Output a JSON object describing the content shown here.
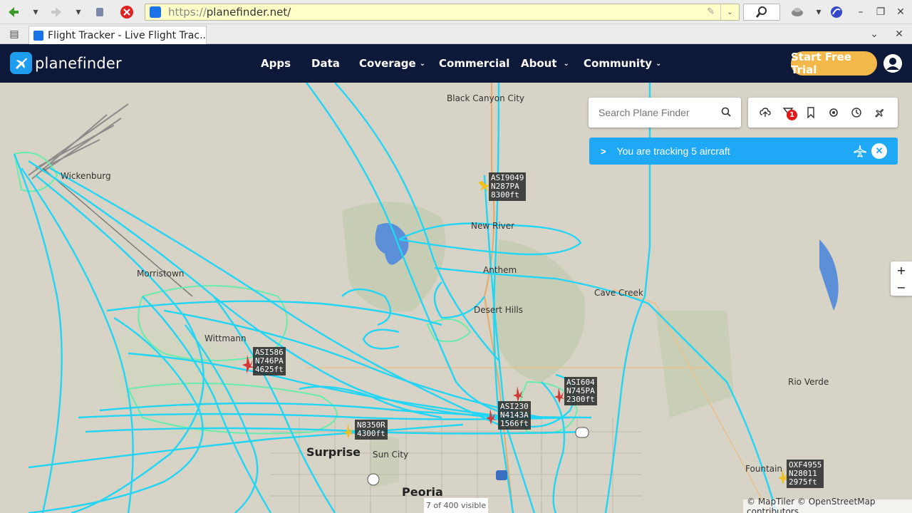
{
  "browser": {
    "url_scheme": "https://",
    "url_host": "planefinder.net/",
    "tab_title": "Flight Tracker - Live Flight Trac..."
  },
  "site": {
    "logo_text": "planefinder",
    "nav": [
      {
        "label": "Apps",
        "has_menu": false
      },
      {
        "label": "Data",
        "has_menu": false
      },
      {
        "label": "Coverage",
        "has_menu": true
      },
      {
        "label": "Commercial",
        "has_menu": false
      },
      {
        "label": "About",
        "has_menu": true
      },
      {
        "label": "Community",
        "has_menu": true
      }
    ],
    "trial_label": "Start Free Trial"
  },
  "search": {
    "placeholder": "Search Plane Finder"
  },
  "toolbar_icons": [
    "cloud-upload-icon",
    "filter-icon",
    "bookmark-icon",
    "settings-icon",
    "history-icon",
    "aircraft-icon"
  ],
  "filter_badge": "1",
  "tracking": {
    "text": "You are tracking 5 aircraft"
  },
  "zoom": {
    "in": "+",
    "out": "−"
  },
  "status": {
    "visible": "7 of 400 visible",
    "attribution": "© MapTiler © OpenStreetMap contributors"
  },
  "places": [
    {
      "name": "Black Canyon City",
      "big": false
    },
    {
      "name": "Wickenburg",
      "big": false
    },
    {
      "name": "New River",
      "big": false
    },
    {
      "name": "Anthem",
      "big": false
    },
    {
      "name": "Cave Creek",
      "big": false
    },
    {
      "name": "Desert Hills",
      "big": false
    },
    {
      "name": "Morristown",
      "big": false
    },
    {
      "name": "Wittmann",
      "big": false
    },
    {
      "name": "Rio Verde",
      "big": false
    },
    {
      "name": "Surprise",
      "big": true
    },
    {
      "name": "Sun City",
      "big": false
    },
    {
      "name": "Peoria",
      "big": true
    },
    {
      "name": "Fountain",
      "big": false
    }
  ],
  "aircraft": [
    {
      "callsign": "ASI9049",
      "reg": "N287PA",
      "alt": "8300ft",
      "color": "#f0c020"
    },
    {
      "callsign": "ASI586",
      "reg": "N746PA",
      "alt": "4625ft",
      "color": "#d23a3a"
    },
    {
      "callsign": "ASI604",
      "reg": "N745PA",
      "alt": "2300ft",
      "color": "#d23a3a"
    },
    {
      "callsign": "ASI230",
      "reg": "N4143A",
      "alt": "1566ft",
      "color": "#d23a3a"
    },
    {
      "callsign": "",
      "reg": "N8350R",
      "alt": "4300ft",
      "color": "#f0c020"
    },
    {
      "callsign": "OXF4955",
      "reg": "N28011",
      "alt": "2975ft",
      "color": "#f0c020"
    }
  ],
  "colors": {
    "track_primary": "#22d5f5",
    "track_secondary": "#5ef0a8",
    "header_bg": "#0e1838",
    "accent": "#1fa8f5",
    "trial": "#f2b94a"
  }
}
